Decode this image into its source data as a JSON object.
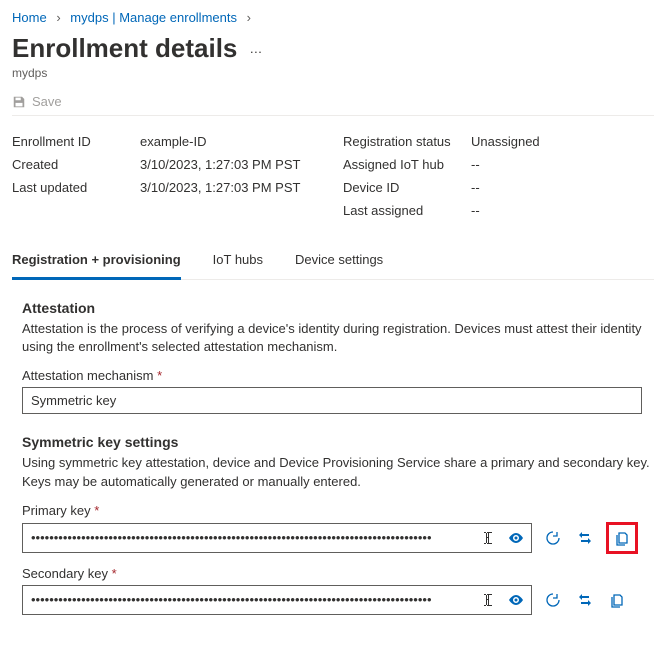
{
  "breadcrumb": {
    "home": "Home",
    "parent": "mydps",
    "section": "Manage enrollments"
  },
  "page": {
    "title": "Enrollment details",
    "subtitle": "mydps"
  },
  "commands": {
    "save": "Save"
  },
  "summary": {
    "enrollment_id_label": "Enrollment ID",
    "enrollment_id": "example-ID",
    "created_label": "Created",
    "created": "3/10/2023, 1:27:03 PM PST",
    "last_updated_label": "Last updated",
    "last_updated": "3/10/2023, 1:27:03 PM PST",
    "registration_status_label": "Registration status",
    "registration_status": "Unassigned",
    "assigned_hub_label": "Assigned IoT hub",
    "assigned_hub": "--",
    "device_id_label": "Device ID",
    "device_id": "--",
    "last_assigned_label": "Last assigned",
    "last_assigned": "--"
  },
  "tabs": {
    "reg_prov": "Registration + provisioning",
    "iothubs": "IoT hubs",
    "device_settings": "Device settings"
  },
  "attestation": {
    "heading": "Attestation",
    "desc": "Attestation is the process of verifying a device's identity during registration. Devices must attest their identity using the enrollment's selected attestation mechanism.",
    "mechanism_label": "Attestation mechanism",
    "mechanism_value": "Symmetric key"
  },
  "symkey": {
    "heading": "Symmetric key settings",
    "desc": "Using symmetric key attestation, device and Device Provisioning Service share a primary and secondary key. Keys may be automatically generated or manually entered.",
    "primary_label": "Primary key",
    "secondary_label": "Secondary key",
    "mask": "••••••••••••••••••••••••••••••••••••••••••••••••••••••••••••••••••••••••••••••••••••••••"
  }
}
